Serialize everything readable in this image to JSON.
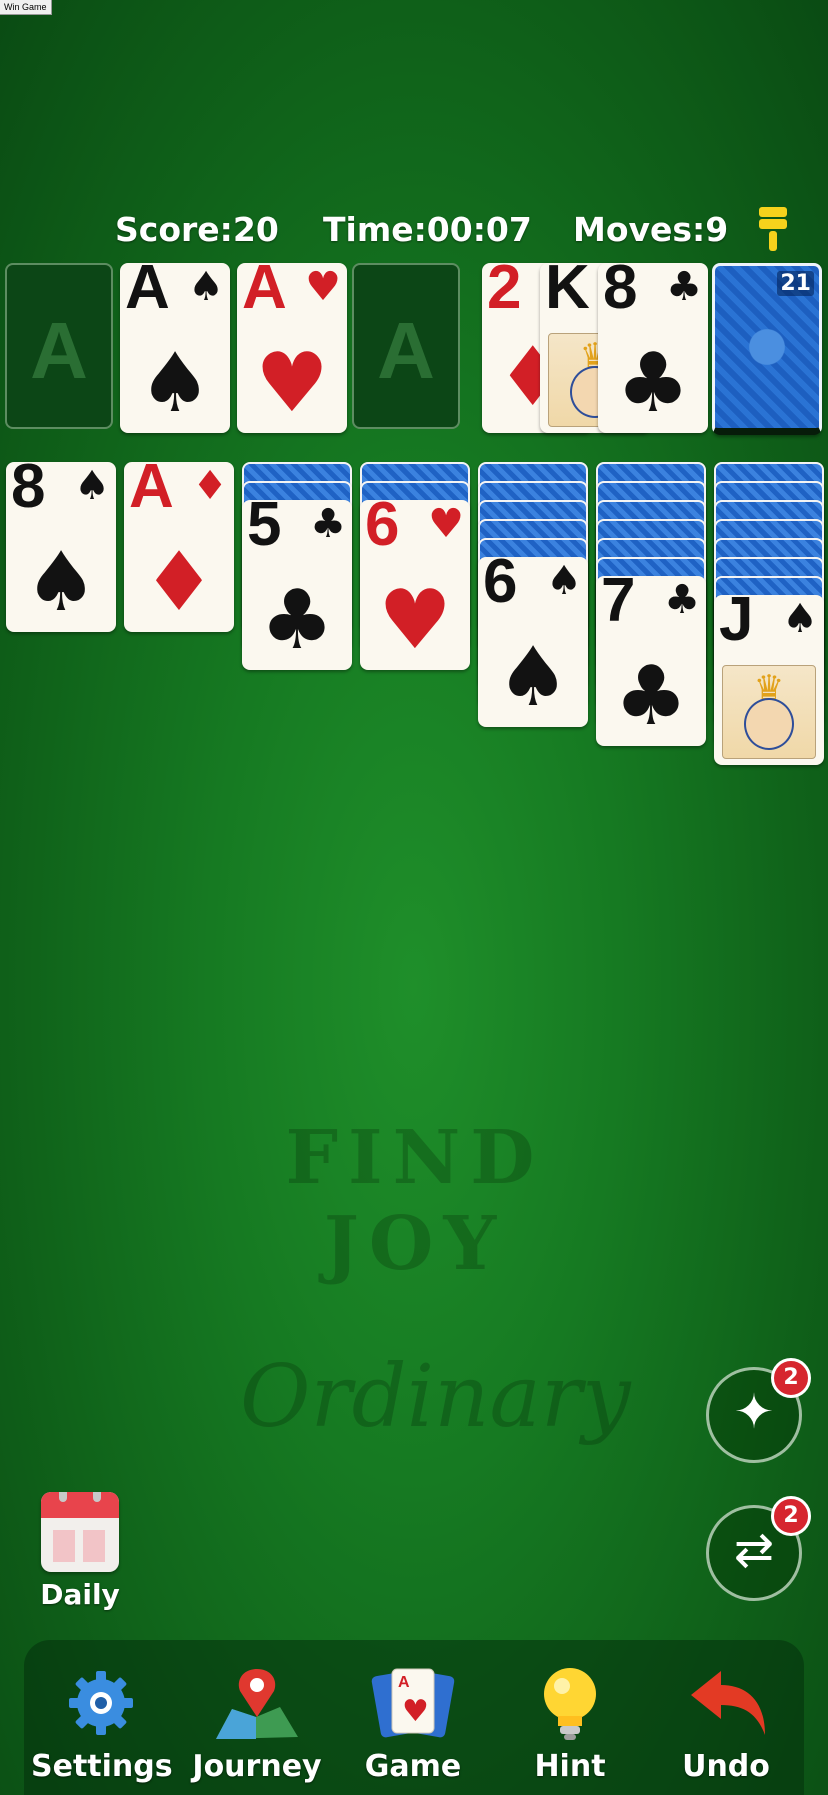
{
  "window_label": "Win Game",
  "hud": {
    "score": "Score:20",
    "time": "Time:00:07",
    "moves": "Moves:9"
  },
  "foundations": [
    {
      "placeholder": "A",
      "rank": "",
      "suit": ""
    },
    {
      "placeholder": "",
      "rank": "A",
      "suit": "♠",
      "color": "black"
    },
    {
      "placeholder": "",
      "rank": "A",
      "suit": "♥",
      "color": "red"
    },
    {
      "placeholder": "A",
      "rank": "",
      "suit": ""
    }
  ],
  "waste": [
    {
      "rank": "2",
      "suit": "♦",
      "color": "red"
    },
    {
      "rank": "K",
      "suit": "",
      "color": "black"
    },
    {
      "rank": "8",
      "suit": "♣",
      "color": "black"
    }
  ],
  "stock": {
    "count": "21"
  },
  "tableau": [
    {
      "hidden": 0,
      "rank": "8",
      "suit": "♠",
      "color": "black"
    },
    {
      "hidden": 0,
      "rank": "A",
      "suit": "♦",
      "color": "red"
    },
    {
      "hidden": 2,
      "rank": "5",
      "suit": "♣",
      "color": "black"
    },
    {
      "hidden": 2,
      "rank": "6",
      "suit": "♥",
      "color": "red"
    },
    {
      "hidden": 5,
      "rank": "6",
      "suit": "♠",
      "color": "black"
    },
    {
      "hidden": 6,
      "rank": "7",
      "suit": "♣",
      "color": "black"
    },
    {
      "hidden": 7,
      "rank": "J",
      "suit": "♠",
      "color": "black"
    }
  ],
  "watermark": {
    "line1": "FIND JOY",
    "line2": "Ordinary"
  },
  "power_ups": {
    "magic_count": "2",
    "shuffle_count": "2"
  },
  "daily": {
    "label": "Daily"
  },
  "nav": {
    "settings": "Settings",
    "journey": "Journey",
    "game": "Game",
    "hint": "Hint",
    "undo": "Undo"
  },
  "colors": {
    "felt": "#167a22",
    "red_suit": "#d21f26",
    "card_face": "#fbf8ef",
    "badge": "#d6262f"
  },
  "icons": [
    "brush-icon",
    "magic-wand-icon",
    "shuffle-icon",
    "calendar-icon",
    "gear-icon",
    "map-pin-icon",
    "cards-icon",
    "lightbulb-icon",
    "undo-arrow-icon"
  ]
}
